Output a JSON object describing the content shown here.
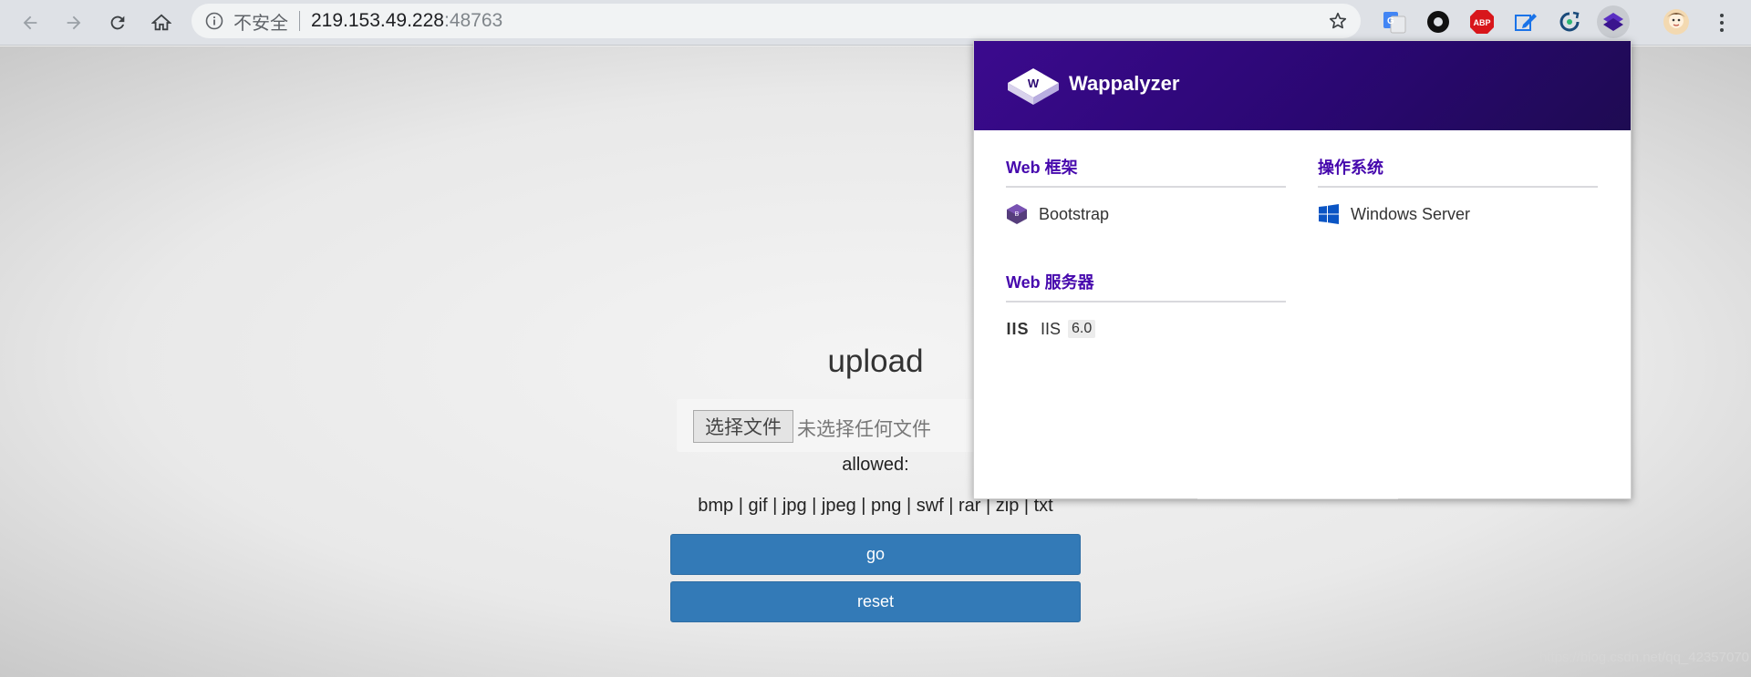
{
  "browser": {
    "address": {
      "security_label": "不安全",
      "host": "219.153.49.228",
      "port": ":48763"
    },
    "extensions": [
      "google-translate-icon",
      "circle-extension-icon",
      "adblock-plus-icon",
      "edit-extension-icon",
      "refresh-extension-icon",
      "wappalyzer-icon"
    ],
    "abp_label": "ABP"
  },
  "page": {
    "title": "upload",
    "file_button": "选择文件",
    "file_status": "未选择任何文件",
    "allowed_label": "allowed:",
    "extensions_text": "bmp | gif | jpg | jpeg | png | swf | rar | zip | txt",
    "go_button": "go",
    "reset_button": "reset",
    "watermark": "https://blog.csdn.net/qq_42357070"
  },
  "wappalyzer": {
    "brand": "Wappalyzer",
    "logo_letter": "W",
    "categories": [
      {
        "title": "Web 框架",
        "items": [
          {
            "name": "Bootstrap",
            "icon": "bootstrap-icon"
          }
        ]
      },
      {
        "title": "操作系统",
        "items": [
          {
            "name": "Windows Server",
            "icon": "windows-icon"
          }
        ]
      },
      {
        "title": "Web 服务器",
        "items": [
          {
            "name": "IIS",
            "version": "6.0",
            "icon": "iis-icon",
            "icon_text": "IIS"
          }
        ]
      }
    ]
  },
  "colors": {
    "accent_purple": "#4608ad",
    "button_blue": "#337ab7"
  }
}
